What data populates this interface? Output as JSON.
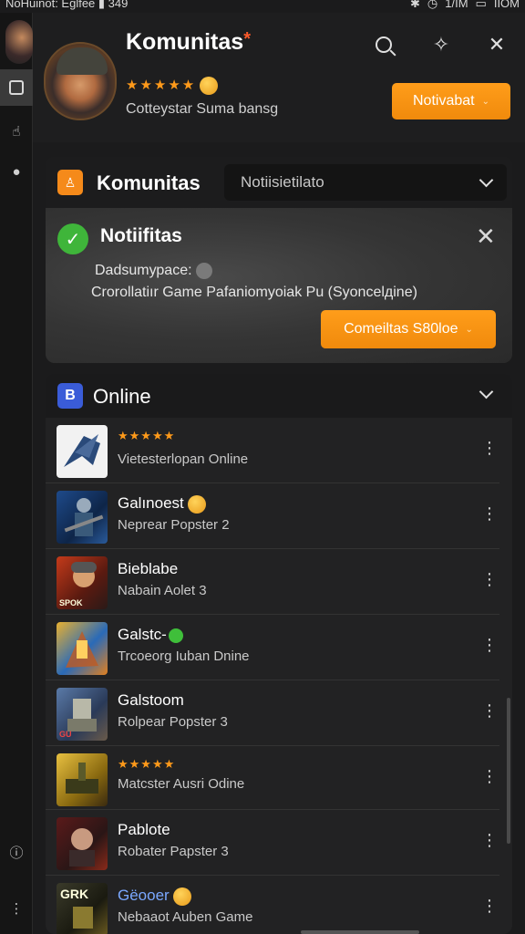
{
  "status_bar": {
    "left": "NoHuinot: Eglfee",
    "battery_text": "349",
    "right_signal": "1/IM",
    "right_label": "IIOM"
  },
  "header": {
    "title": "Komunitas",
    "title_mark": "*",
    "rating_stars": "★★★★★",
    "subtitle": "Cotteystar Suma bansg",
    "notify_button": "Notivabat"
  },
  "community_panel": {
    "badge": "♙",
    "title": "Komunitas",
    "select_value": "Notiisietilato"
  },
  "notification": {
    "title": "Notiifitas",
    "line1": "Dadsumурace:",
    "line2": "Crorollatiır Game Pafaniomyoiak Pu (Syoncelдine)",
    "action_button": "Comeiltas S80loe"
  },
  "online_panel": {
    "badge": "B",
    "title": "Online",
    "items": [
      {
        "title": "",
        "stars": "★★★★★",
        "subtitle": "Vietesterlopan Online"
      },
      {
        "title": "Galınoest",
        "stars": "",
        "subtitle": "Neprear Popster 2"
      },
      {
        "title": "Bieblabe",
        "stars": "",
        "subtitle": "Nabain Aolet 3"
      },
      {
        "title": "Galstc-",
        "stars": "",
        "subtitle": "Trcoeorg Iuban Dnine"
      },
      {
        "title": "Galstoom",
        "stars": "",
        "subtitle": "Rolpear Popster 3"
      },
      {
        "title": "",
        "stars": "★★★★★",
        "subtitle": "Matcster Ausri Odine"
      },
      {
        "title": "Pablote",
        "stars": "",
        "subtitle": "Robater Papster 3"
      },
      {
        "title": "Gëooer",
        "stars": "",
        "subtitle": "Nebaaot Auben Game"
      }
    ],
    "thumb_label_3": "SPOK",
    "thumb_label_5": "GU",
    "thumb_label_8": "GRK"
  },
  "colors": {
    "accent_orange": "#f58a1a",
    "success_green": "#3fb53a",
    "badge_blue": "#3a5cd8",
    "background": "#1b1b1c"
  },
  "icons": [
    "search-icon",
    "sparkle-icon",
    "close-icon",
    "chevron-down-icon",
    "more-vert-icon",
    "check-icon"
  ]
}
